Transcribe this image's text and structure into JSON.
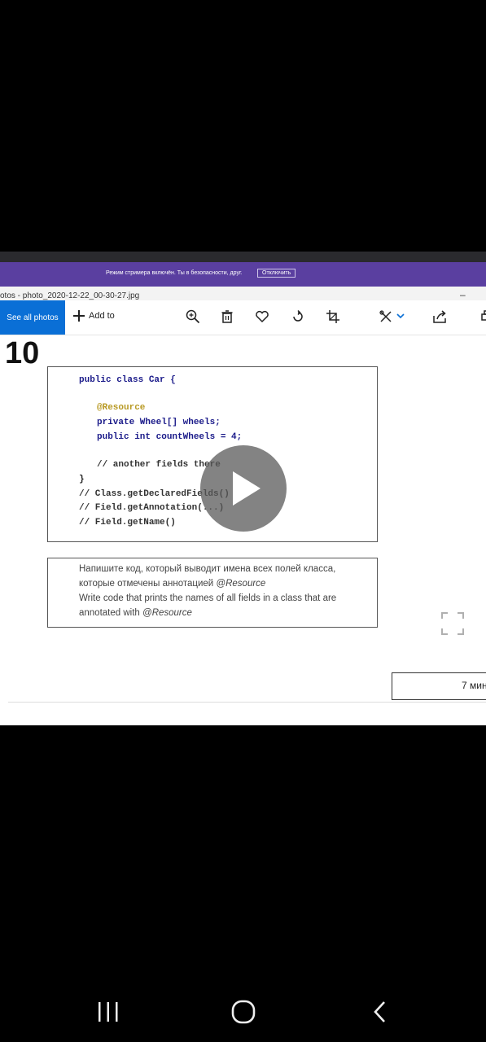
{
  "streamer_banner": {
    "message": "Режим стримера включён. Ты в безопасности, друг.",
    "button": "Отключить"
  },
  "window": {
    "title": "otos - photo_2020-12-22_00-30-27.jpg",
    "minimize": "–"
  },
  "toolbar": {
    "see_all_photos": "See all photos",
    "add_to": "Add to"
  },
  "slide": {
    "number": "10",
    "code_lines": [
      "public class Car {",
      "@Resource",
      "private Wheel[] wheels;",
      "public int countWheels = 4;",
      "// another fields there",
      "}",
      "// Class.getDeclaredFields()",
      "// Field.getAnnotation(...)",
      "// Field.getName()"
    ],
    "task_ru_1": "Напишите код, который выводит имена всех полей класса,",
    "task_ru_2": "которые отмечены аннотацией ",
    "task_ru_ann": "@Resource",
    "task_en_1": "Write code that prints the names of all fields in a class that are",
    "task_en_2": "annotated with ",
    "task_en_ann": "@Resource",
    "timer": "7 мин"
  },
  "colors": {
    "streamer_bg": "#5a3fa0",
    "see_all_bg": "#0a6fd6",
    "annotation": "#b89a25",
    "field": "#8a1e8a",
    "keyword": "#1b1b8a"
  }
}
